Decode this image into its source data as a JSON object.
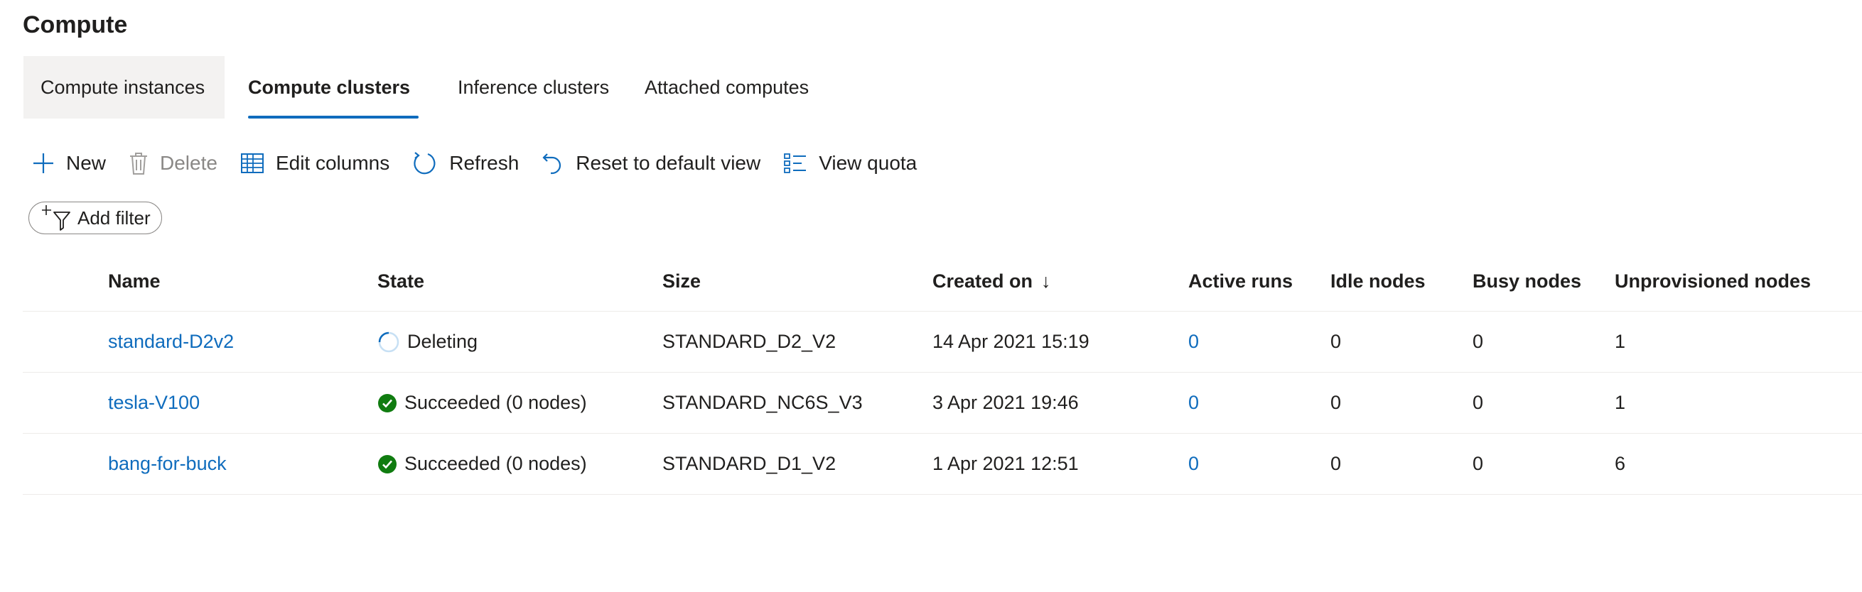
{
  "page": {
    "title": "Compute"
  },
  "tabs": [
    {
      "label": "Compute instances",
      "selected": false
    },
    {
      "label": "Compute clusters",
      "selected": true
    },
    {
      "label": "Inference clusters",
      "selected": false
    },
    {
      "label": "Attached computes",
      "selected": false
    }
  ],
  "toolbar": {
    "new_label": "New",
    "delete_label": "Delete",
    "edit_columns_label": "Edit columns",
    "refresh_label": "Refresh",
    "reset_label": "Reset to default view",
    "view_quota_label": "View quota"
  },
  "filter": {
    "label": "Add filter"
  },
  "table": {
    "columns": [
      "Name",
      "State",
      "Size",
      "Created on",
      "Active runs",
      "Idle nodes",
      "Busy nodes",
      "Unprovisioned nodes"
    ],
    "sort_indicator": "↓",
    "rows": [
      {
        "name": "standard-D2v2",
        "state": "Deleting",
        "state_icon": "spinner-icon",
        "size": "STANDARD_D2_V2",
        "created": "14 Apr 2021 15:19",
        "active_runs": "0",
        "idle_nodes": "0",
        "busy_nodes": "0",
        "unprovisioned_nodes": "1"
      },
      {
        "name": "tesla-V100",
        "state": "Succeeded (0 nodes)",
        "state_icon": "success-check-icon",
        "size": "STANDARD_NC6S_V3",
        "created": "3 Apr 2021 19:46",
        "active_runs": "0",
        "idle_nodes": "0",
        "busy_nodes": "0",
        "unprovisioned_nodes": "1"
      },
      {
        "name": "bang-for-buck",
        "state": "Succeeded (0 nodes)",
        "state_icon": "success-check-icon",
        "size": "STANDARD_D1_V2",
        "created": "1 Apr 2021 12:51",
        "active_runs": "0",
        "idle_nodes": "0",
        "busy_nodes": "0",
        "unprovisioned_nodes": "6"
      }
    ]
  },
  "colors": {
    "accent": "#0f6cbd",
    "success": "#107c10",
    "tab_selected_bg": "#f3f2f1",
    "divider": "#edebe9",
    "disabled": "#8a8886"
  }
}
